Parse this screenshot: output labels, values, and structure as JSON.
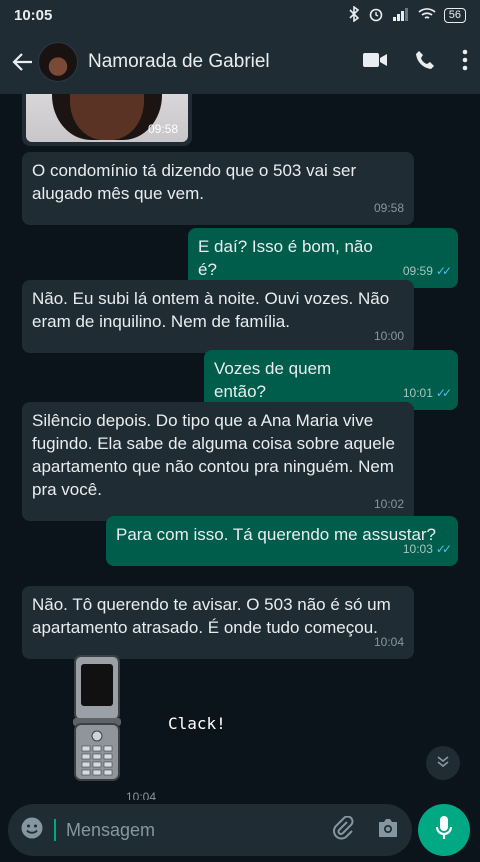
{
  "status_bar": {
    "time": "10:05",
    "battery": "56"
  },
  "header": {
    "title": "Namorada de Gabriel"
  },
  "image_message": {
    "time": "09:58"
  },
  "messages": [
    {
      "dir": "in",
      "text": "O condomínio tá dizendo que o 503 vai ser alugado mês que vem.",
      "time": "09:58"
    },
    {
      "dir": "out",
      "text": "E daí? Isso é bom, não é?",
      "time": "09:59"
    },
    {
      "dir": "in",
      "text": "Não. Eu subi lá ontem à noite. Ouvi vozes. Não eram de inquilino. Nem de família.",
      "time": "10:00"
    },
    {
      "dir": "out",
      "text": "Vozes de quem então?",
      "time": "10:01"
    },
    {
      "dir": "in",
      "text": "Silêncio depois. Do tipo que a Ana Maria vive fugindo. Ela sabe de alguma coisa sobre aquele apartamento que não contou pra ninguém. Nem pra você.",
      "time": "10:02"
    },
    {
      "dir": "out",
      "text": "Para com isso. Tá querendo me assustar?",
      "time": "10:03"
    },
    {
      "dir": "in",
      "text": "Não. Tô querendo te avisar. O 503 não é só um apartamento atrasado. É onde tudo começou.",
      "time": "10:04"
    }
  ],
  "overlay": {
    "sound_text": "Clack!",
    "last_time": "10:04"
  },
  "input": {
    "placeholder": "Mensagem"
  },
  "colors": {
    "header": "#1f2c34",
    "incoming": "#1f2c34",
    "outgoing": "#005c4b",
    "accent": "#00a884",
    "read_ticks": "#53bdeb"
  },
  "icons": [
    "back-arrow-icon",
    "video-call-icon",
    "phone-icon",
    "more-vert-icon",
    "emoji-icon",
    "attach-icon",
    "camera-icon",
    "mic-icon",
    "scroll-down-icon"
  ]
}
